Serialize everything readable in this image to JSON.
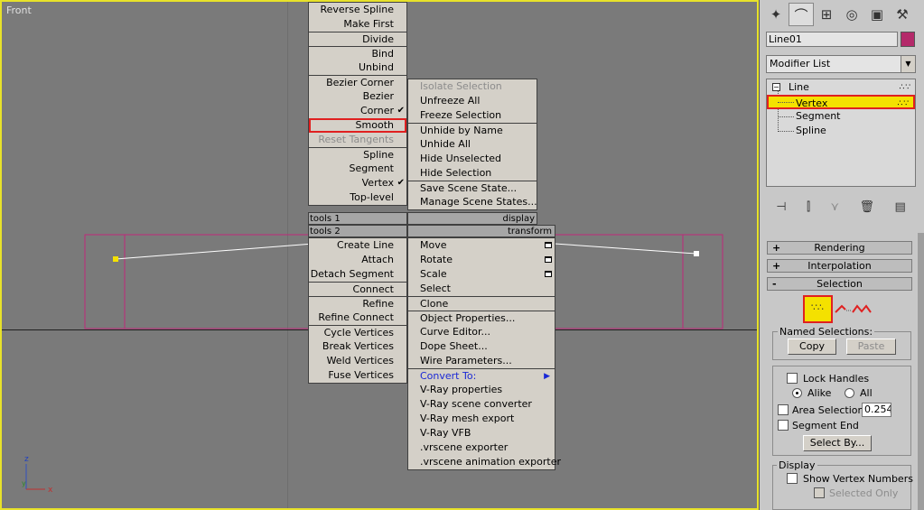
{
  "viewport": {
    "label": "Front",
    "axes": {
      "z": "z",
      "x": "x"
    }
  },
  "quad_menu": {
    "left_top_items": [
      {
        "label": "Reverse Spline"
      },
      {
        "label": "Make First"
      },
      {
        "label": "Divide",
        "sep": true
      },
      {
        "label": "Bind",
        "sep": true
      },
      {
        "label": "Unbind"
      },
      {
        "label": "Bezier Corner",
        "sep": true
      },
      {
        "label": "Bezier"
      },
      {
        "label": "Corner",
        "checked": true
      },
      {
        "label": "Smooth",
        "highlight": true
      },
      {
        "label": "Reset Tangents",
        "disabled": true
      },
      {
        "label": "Spline",
        "sep": true
      },
      {
        "label": "Segment"
      },
      {
        "label": "Vertex",
        "checked": true
      },
      {
        "label": "Top-level"
      }
    ],
    "right_top_items": [
      {
        "label": "Isolate Selection",
        "disabled": true
      },
      {
        "label": "Unfreeze All"
      },
      {
        "label": "Freeze Selection"
      },
      {
        "label": "Unhide by Name",
        "sep": true
      },
      {
        "label": "Unhide All"
      },
      {
        "label": "Hide Unselected"
      },
      {
        "label": "Hide Selection"
      },
      {
        "label": "Save Scene State...",
        "sep": true
      },
      {
        "label": "Manage Scene States..."
      }
    ],
    "left_bottom_items": [
      {
        "label": "Create Line"
      },
      {
        "label": "Attach"
      },
      {
        "label": "Detach Segment"
      },
      {
        "label": "Connect",
        "sep": true
      },
      {
        "label": "Refine",
        "sep": true
      },
      {
        "label": "Refine Connect"
      },
      {
        "label": "Cycle Vertices",
        "sep": true
      },
      {
        "label": "Break Vertices"
      },
      {
        "label": "Weld Vertices"
      },
      {
        "label": "Fuse Vertices"
      }
    ],
    "right_bottom_items": [
      {
        "label": "Move",
        "box": true
      },
      {
        "label": "Rotate",
        "box": true
      },
      {
        "label": "Scale",
        "box": true
      },
      {
        "label": "Select"
      },
      {
        "label": "Clone",
        "sep": true
      },
      {
        "label": "Object Properties...",
        "sep": true
      },
      {
        "label": "Curve Editor..."
      },
      {
        "label": "Dope Sheet..."
      },
      {
        "label": "Wire Parameters..."
      },
      {
        "label": "Convert To:",
        "sep": true,
        "blue": true,
        "submenu": true
      },
      {
        "label": "V-Ray properties"
      },
      {
        "label": "V-Ray scene converter"
      },
      {
        "label": "V-Ray mesh export"
      },
      {
        "label": "V-Ray VFB"
      },
      {
        "label": ".vrscene exporter"
      },
      {
        "label": ".vrscene animation exporter"
      }
    ],
    "quadrant_titles": {
      "tools1": "tools 1",
      "display": "display",
      "tools2": "tools 2",
      "transform": "transform"
    }
  },
  "command_panel": {
    "object_name": "Line01",
    "object_color": "#b42a6a",
    "modifier_list": "Modifier List",
    "stack": {
      "root": "Line",
      "items": [
        "Vertex",
        "Segment",
        "Spline"
      ],
      "selected": "Vertex"
    },
    "rollouts": {
      "rendering": "Rendering",
      "interpolation": "Interpolation",
      "selection": "Selection"
    },
    "named_selections": {
      "label": "Named Selections:",
      "copy": "Copy",
      "paste": "Paste"
    },
    "options": {
      "lock_handles": "Lock Handles",
      "alike": "Alike",
      "all": "All",
      "area_selection": "Area Selection:",
      "area_value": "0.254",
      "segment_end": "Segment End",
      "select_by": "Select By..."
    },
    "display": {
      "label": "Display",
      "show_vertex_numbers": "Show Vertex Numbers",
      "selected_only": "Selected Only"
    }
  },
  "colors": {
    "viewport_border": "#e8e22a",
    "highlight_outline": "#e02020",
    "selection_yellow": "#f4e100",
    "spline_bbox": "#c0287a"
  }
}
